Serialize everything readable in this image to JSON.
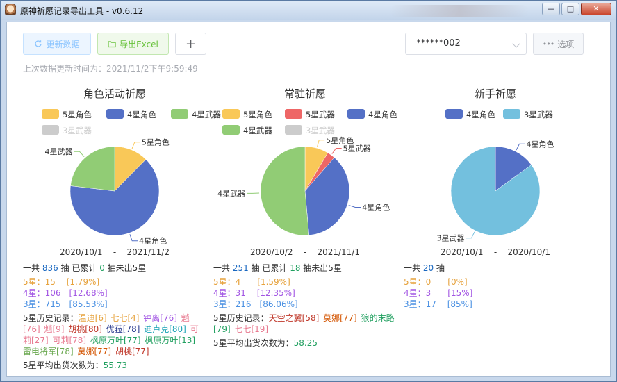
{
  "window": {
    "title": "原神祈愿记录导出工具 - v0.6.12",
    "min": "—",
    "max": "□",
    "close": "✕"
  },
  "toolbar": {
    "refresh_label": "更新数据",
    "export_label": "导出Excel",
    "plus_label": "+",
    "uid_value": "******002",
    "options_label": "选项",
    "icons": {
      "refresh": "refresh-icon",
      "export": "folder-icon",
      "options": "ellipsis-icon"
    }
  },
  "last_update": "上次数据更新时间为：2021/11/2下午9:59:49",
  "colors": {
    "5星角色": "#f9c858",
    "4星角色": "#5470c6",
    "4星武器": "#91cc75",
    "3星武器": "#73c0de",
    "5星武器": "#ee6666",
    "off": "#cccccc"
  },
  "panels": [
    {
      "title": "角色活动祈愿",
      "legend": [
        {
          "name": "5星角色",
          "color": "#f9c858",
          "active": true
        },
        {
          "name": "4星角色",
          "color": "#5470c6",
          "active": true
        },
        {
          "name": "4星武器",
          "color": "#91cc75",
          "active": true
        },
        {
          "name": "3星武器",
          "color": "#cccccc",
          "active": false
        }
      ],
      "chart_data": {
        "type": "pie",
        "slices": [
          {
            "name": "5星角色",
            "value": 15,
            "color": "#f9c858"
          },
          {
            "name": "4星角色",
            "value": 78,
            "color": "#5470c6"
          },
          {
            "name": "4星武器",
            "value": 28,
            "color": "#91cc75"
          }
        ]
      },
      "range_start": "2020/10/1",
      "range_sep": "-",
      "range_end": "2021/11/2",
      "total_pre": "一共 ",
      "total": "836",
      "total_mid": " 抽 已累计 ",
      "pity": "0",
      "total_post": " 抽未出5星",
      "s5": "5星：15　 [1.79%]",
      "s4": "4星：106　[12.68%]",
      "s3": "3星：715　[85.53%]",
      "history_label": "5星历史记录：",
      "history": [
        {
          "t": "温迪[6]",
          "c": "#e6a23c"
        },
        {
          "t": "七七[4]",
          "c": "#e6a23c"
        },
        {
          "t": "钟离[76]",
          "c": "#a256e3"
        },
        {
          "t": "魈[76]",
          "c": "#e87a90"
        },
        {
          "t": "魈[9]",
          "c": "#e87a90"
        },
        {
          "t": "胡桃[80]",
          "c": "#c0392b"
        },
        {
          "t": "优菈[78]",
          "c": "#2c3e90"
        },
        {
          "t": "迪卢克[80]",
          "c": "#1aa3b5"
        },
        {
          "t": "可莉[27]",
          "c": "#e87a90"
        },
        {
          "t": "可莉[78]",
          "c": "#e87a90"
        },
        {
          "t": "枫原万叶[77]",
          "c": "#21a060"
        },
        {
          "t": "枫原万叶[13]",
          "c": "#21a060"
        },
        {
          "t": "雷电将军[78]",
          "c": "#6aa84f"
        },
        {
          "t": "莫娜[77]",
          "c": "#d35400"
        },
        {
          "t": "胡桃[77]",
          "c": "#c0392b"
        }
      ],
      "avg_label": "5星平均出货次数为：",
      "avg": "55.73"
    },
    {
      "title": "常驻祈愿",
      "legend": [
        {
          "name": "5星角色",
          "color": "#f9c858",
          "active": true
        },
        {
          "name": "5星武器",
          "color": "#ee6666",
          "active": true
        },
        {
          "name": "4星角色",
          "color": "#5470c6",
          "active": true
        },
        {
          "name": "4星武器",
          "color": "#91cc75",
          "active": true
        },
        {
          "name": "3星武器",
          "color": "#cccccc",
          "active": false
        }
      ],
      "chart_data": {
        "type": "pie",
        "slices": [
          {
            "name": "5星角色",
            "value": 3,
            "color": "#f9c858"
          },
          {
            "name": "5星武器",
            "value": 1,
            "color": "#ee6666"
          },
          {
            "name": "4星角色",
            "value": 13,
            "color": "#5470c6"
          },
          {
            "name": "4星武器",
            "value": 18,
            "color": "#91cc75"
          }
        ]
      },
      "range_start": "2020/10/2",
      "range_sep": "-",
      "range_end": "2021/11/1",
      "total_pre": "一共 ",
      "total": "251",
      "total_mid": " 抽 已累计 ",
      "pity": "18",
      "total_post": " 抽未出5星",
      "s5": "5星：4　　[1.59%]",
      "s4": "4星：31　 [12.35%]",
      "s3": "3星：216　[86.06%]",
      "history_label": "5星历史记录：",
      "history": [
        {
          "t": "天空之翼[58]",
          "c": "#c0392b"
        },
        {
          "t": "莫娜[77]",
          "c": "#d35400"
        },
        {
          "t": "狼的末路[79]",
          "c": "#21a060"
        },
        {
          "t": "七七[19]",
          "c": "#e87a90"
        }
      ],
      "avg_label": "5星平均出货次数为：",
      "avg": "58.25"
    },
    {
      "title": "新手祈愿",
      "legend": [
        {
          "name": "4星角色",
          "color": "#5470c6",
          "active": true
        },
        {
          "name": "3星武器",
          "color": "#73c0de",
          "active": true
        }
      ],
      "chart_data": {
        "type": "pie",
        "slices": [
          {
            "name": "4星角色",
            "value": 3,
            "color": "#5470c6"
          },
          {
            "name": "3星武器",
            "value": 17,
            "color": "#73c0de"
          }
        ]
      },
      "range_start": "2020/10/1",
      "range_sep": "-",
      "range_end": "2020/10/1",
      "total_pre": "一共 ",
      "total": "20",
      "total_mid": " 抽",
      "pity": "",
      "total_post": "",
      "s5": "5星：0　　[0%]",
      "s4": "4星：3　　[15%]",
      "s3": "3星：17　 [85%]",
      "history_label": "",
      "history": [],
      "avg_label": "",
      "avg": ""
    }
  ]
}
